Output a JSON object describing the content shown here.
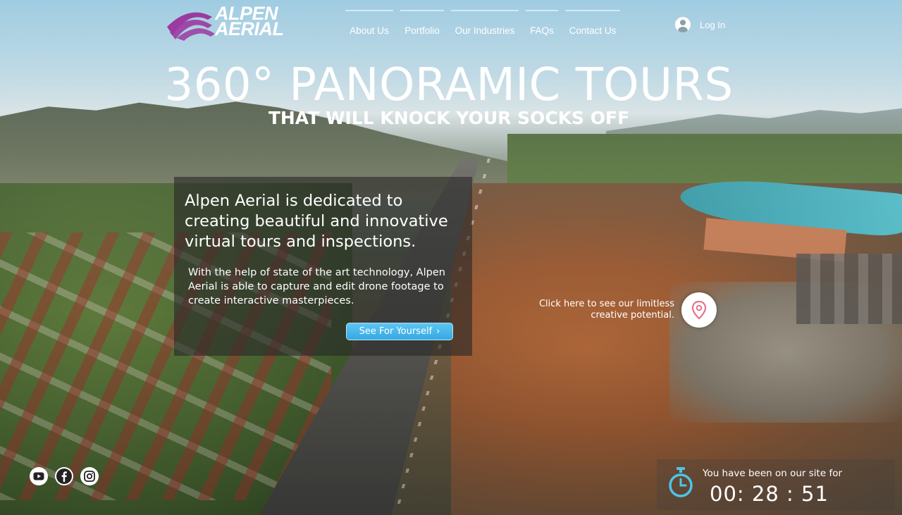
{
  "brand": {
    "line1": "ALPEN",
    "line2": "AERIAL",
    "logo_color": "#9b3aa0"
  },
  "nav": {
    "items": [
      {
        "label": "About Us"
      },
      {
        "label": "Portfolio"
      },
      {
        "label": "Our Industries"
      },
      {
        "label": "FAQs"
      },
      {
        "label": "Contact Us"
      }
    ]
  },
  "account": {
    "login_label": "Log In",
    "icon": "user-avatar-icon"
  },
  "hero": {
    "title": "360° PANORAMIC TOURS",
    "subtitle": "THAT WILL KNOCK YOUR SOCKS OFF"
  },
  "panel": {
    "heading": "Alpen Aerial is dedicated to creating beautiful and innovative virtual tours and inspections.",
    "body": "With the help of state of the art technology, Alpen Aerial is able to capture and edit drone footage to create interactive masterpieces.",
    "cta_label": "See For Yourself",
    "cta_color": "#3fb1e8"
  },
  "hotspot": {
    "text": "Click here to see our limitless creative potential.",
    "icon": "map-pin-icon",
    "pin_color": "#e8718b"
  },
  "social": {
    "items": [
      {
        "name": "youtube-icon"
      },
      {
        "name": "facebook-icon"
      },
      {
        "name": "instagram-icon"
      }
    ]
  },
  "timer": {
    "label": "You have been on our site for",
    "value": "00: 28 : 51",
    "icon": "stopwatch-icon",
    "icon_color": "#4fc3e8"
  }
}
